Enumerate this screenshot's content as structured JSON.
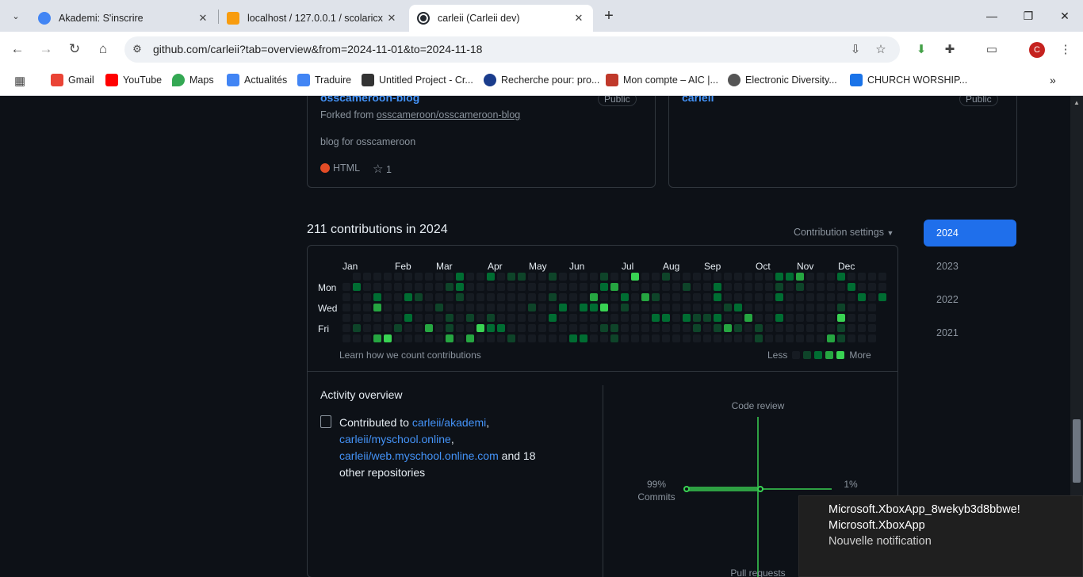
{
  "browser": {
    "tabs": [
      {
        "title": "Akademi: S'inscrire",
        "favicon_color": "#4285f4",
        "active": false
      },
      {
        "title": "localhost / 127.0.0.1 / scolaricx",
        "favicon_color": "#f89c0e",
        "active": false
      },
      {
        "title": "carleii (Carleii dev)",
        "favicon_color": "#24292f",
        "active": true
      }
    ],
    "url": "github.com/carleii?tab=overview&from=2024-11-01&to=2024-11-18",
    "profile_initial": "C",
    "bookmarks": [
      {
        "label": "Gmail",
        "color": "#ea4335"
      },
      {
        "label": "YouTube",
        "color": "#ff0000"
      },
      {
        "label": "Maps",
        "color": "#34a853"
      },
      {
        "label": "Actualités",
        "color": "#4285f4"
      },
      {
        "label": "Traduire",
        "color": "#4285f4"
      },
      {
        "label": "Untitled Project - Cr...",
        "color": "#333333"
      },
      {
        "label": "Recherche pour: pro...",
        "color": "#1a3c8c"
      },
      {
        "label": "Mon compte – AIC |...",
        "color": "#c0392b"
      },
      {
        "label": "Electronic Diversity...",
        "color": "#555555"
      },
      {
        "label": "CHURCH WORSHIP...",
        "color": "#1a73e8"
      }
    ]
  },
  "repos": [
    {
      "name": "osscameroon-blog",
      "visibility": "Public",
      "forked_prefix": "Forked from",
      "forked_from": "osscameroon/osscameroon-blog",
      "description": "blog for osscameroon",
      "language": "HTML",
      "stars": "1"
    },
    {
      "name": "carleii",
      "visibility": "Public"
    }
  ],
  "contributions": {
    "title": "211 contributions in 2024",
    "settings_label": "Contribution settings",
    "months": [
      "Jan",
      "Feb",
      "Mar",
      "Apr",
      "May",
      "Jun",
      "Jul",
      "Aug",
      "Sep",
      "Oct",
      "Nov",
      "Dec"
    ],
    "day_labels": [
      "Mon",
      "Wed",
      "Fri"
    ],
    "learn_link": "Learn how we count contributions",
    "legend_less": "Less",
    "legend_more": "More",
    "level_colors": [
      "#161b22",
      "#0e4429",
      "#006d32",
      "#26a641",
      "#39d353"
    ]
  },
  "activity": {
    "title": "Activity overview",
    "prefix": "Contributed to",
    "repos": [
      "carleii/akademi",
      "carleii/myschool.online",
      "carleii/web.myschool.online.com"
    ],
    "suffix": "and 18 other repositories",
    "chart": {
      "code_review": "Code review",
      "pull_requests": "Pull requests",
      "commits_pct": "99%",
      "commits_label": "Commits",
      "issues_pct": "1%"
    }
  },
  "years": [
    "2024",
    "2023",
    "2022",
    "2021"
  ],
  "notification": {
    "line1": "Microsoft.XboxApp_8wekyb3d8bbwe!",
    "line2": "Microsoft.XboxApp",
    "line3": "Nouvelle notification"
  }
}
